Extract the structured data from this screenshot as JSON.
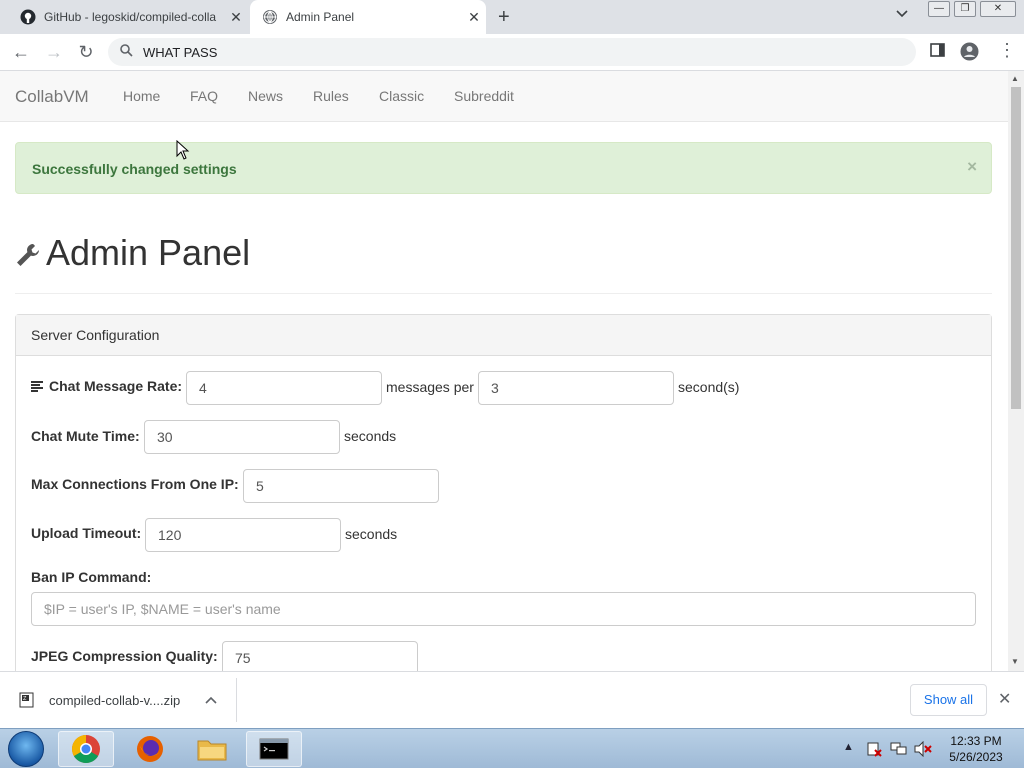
{
  "browser": {
    "tabs": [
      {
        "title": "GitHub - legoskid/compiled-colla",
        "favicon": "github-icon"
      },
      {
        "title": "Admin Panel",
        "favicon": "globe-icon"
      }
    ],
    "address": "WHAT PASS"
  },
  "site": {
    "brand": "CollabVM",
    "nav": [
      "Home",
      "FAQ",
      "News",
      "Rules",
      "Classic",
      "Subreddit"
    ]
  },
  "alert": {
    "message": "Successfully changed settings",
    "close": "×",
    "color": "#dff0d8"
  },
  "page": {
    "title": "Admin Panel"
  },
  "panel": {
    "heading": "Server Configuration",
    "chat_rate": {
      "label": "Chat Message Rate:",
      "messages": "4",
      "mid_text": "messages per",
      "seconds": "3",
      "unit": "second(s)"
    },
    "mute_time": {
      "label": "Chat Mute Time:",
      "value": "30",
      "unit": "seconds"
    },
    "max_conn": {
      "label": "Max Connections From One IP:",
      "value": "5"
    },
    "upload_timeout": {
      "label": "Upload Timeout:",
      "value": "120",
      "unit": "seconds"
    },
    "ban_cmd": {
      "label": "Ban IP Command:",
      "placeholder": "$IP = user's IP, $NAME = user's name"
    },
    "jpeg_quality": {
      "label": "JPEG Compression Quality:",
      "value": "75"
    }
  },
  "download": {
    "file": "compiled-collab-v....zip",
    "show_all": "Show all"
  },
  "taskbar": {
    "time": "12:33 PM",
    "date": "5/26/2023"
  }
}
